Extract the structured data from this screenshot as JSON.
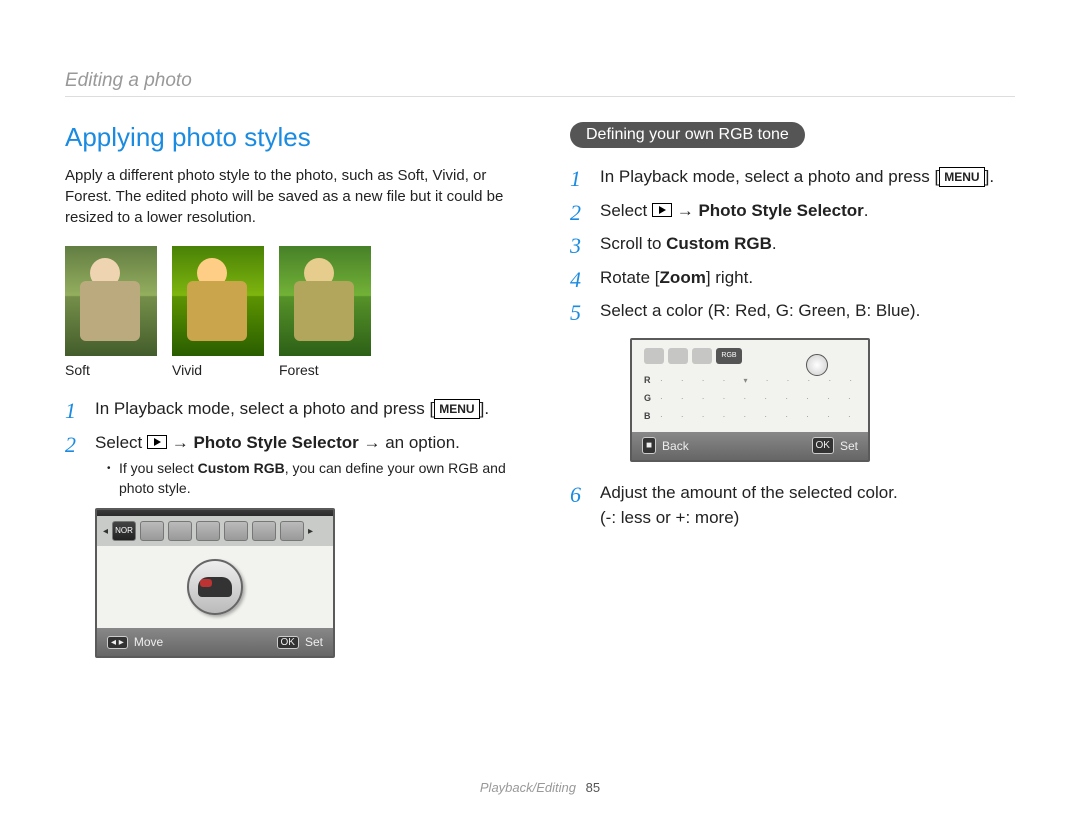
{
  "breadcrumb": "Editing a photo",
  "section_title": "Applying photo styles",
  "intro": "Apply a different photo style to the photo, such as Soft, Vivid, or Forest. The edited photo will be saved as a new file but it could be resized to a lower resolution.",
  "thumbs": [
    "Soft",
    "Vivid",
    "Forest"
  ],
  "left_steps": {
    "s1_a": "In Playback mode, select a photo and press [",
    "s1_b": "].",
    "menu_label": "MENU",
    "s2_a": "Select ",
    "s2_b": " → ",
    "s2_bold": "Photo Style Selector",
    "s2_c": " → an option.",
    "bullet_a": "If you select ",
    "bullet_bold": "Custom RGB",
    "bullet_b": ", you can define your own RGB and photo style."
  },
  "lcd_style": {
    "tab_label": "NOR",
    "foot_move_icon": "◂ ▸",
    "foot_move": "Move",
    "foot_ok": "OK",
    "foot_set": "Set"
  },
  "pill": "Defining your own RGB tone",
  "right_steps": {
    "s1_a": "In Playback mode, select a photo and press [",
    "s1_b": "].",
    "s2_a": "Select ",
    "s2_b": " → ",
    "s2_bold": "Photo Style Selector",
    "s2_c": ".",
    "s3_a": "Scroll to ",
    "s3_bold": "Custom RGB",
    "s3_b": ".",
    "s4_a": "Rotate [",
    "s4_bold": "Zoom",
    "s4_b": "] right.",
    "s5": "Select a color (R: Red, G: Green, B: Blue).",
    "s6_a": "Adjust the amount of the selected color.",
    "s6_b": "(-: less or +: more)"
  },
  "lcd_rgb": {
    "tab_label": "RGB",
    "rows": [
      "R",
      "G",
      "B"
    ],
    "foot_back_icon": "■",
    "foot_back": "Back",
    "foot_ok": "OK",
    "foot_set": "Set"
  },
  "footer_section": "Playback/Editing",
  "footer_page": "85"
}
